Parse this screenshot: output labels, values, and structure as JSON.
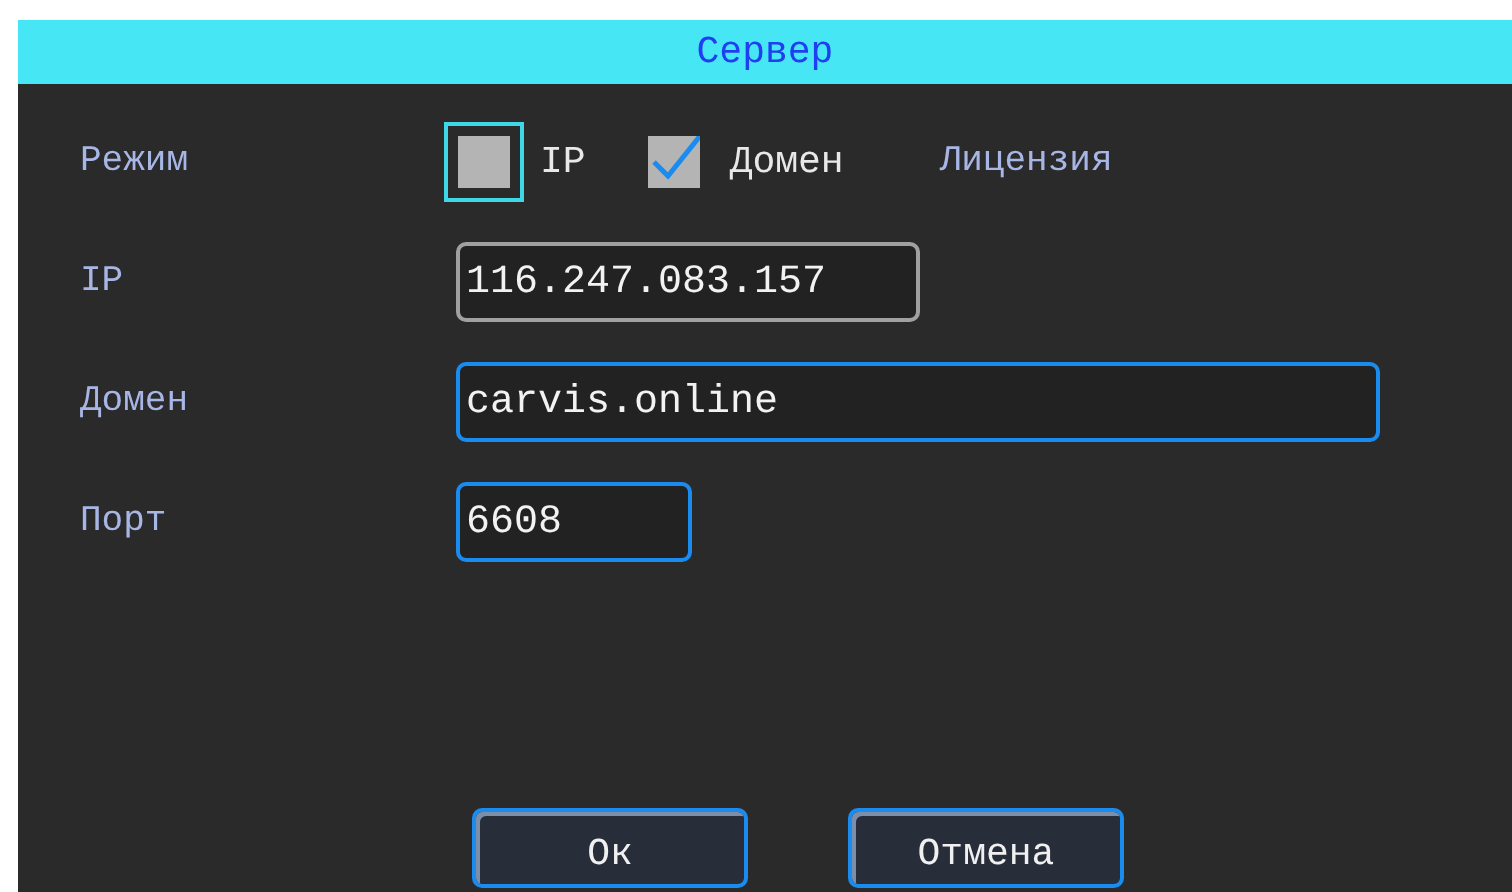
{
  "window": {
    "title": "Сервер"
  },
  "mode": {
    "label": "Режим",
    "options": [
      {
        "label": "IP",
        "checked": false,
        "focused": true
      },
      {
        "label": "Домен",
        "checked": true,
        "focused": false
      }
    ],
    "license": "Лицензия"
  },
  "fields": [
    {
      "label": "IP",
      "value": "116.247.083.157",
      "disabled": true
    },
    {
      "label": "Домен",
      "value": "carvis.online",
      "disabled": false
    },
    {
      "label": "Порт",
      "value": "6608",
      "disabled": false
    }
  ],
  "buttons": [
    {
      "label": "Ок"
    },
    {
      "label": "Отмена"
    }
  ]
}
